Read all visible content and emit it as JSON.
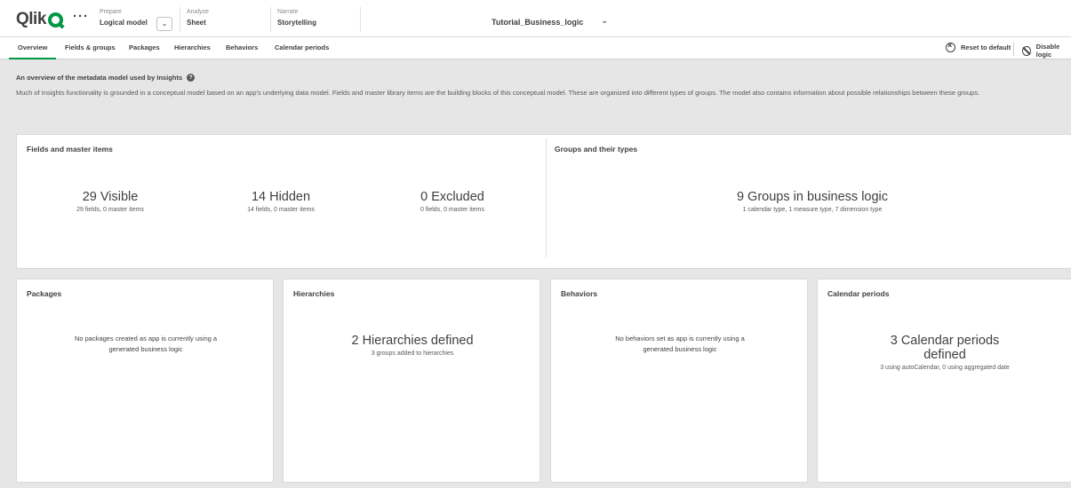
{
  "header": {
    "logo_text": "Qlik",
    "more_label": "···",
    "prepare": {
      "caption": "Prepare",
      "value": "Logical model"
    },
    "dropdown_icon": "chevron-down",
    "analyze": {
      "caption": "Analyze",
      "value": "Sheet"
    },
    "narrate": {
      "caption": "Narrate",
      "value": "Storytelling"
    },
    "app_title": "Tutorial_Business_logic",
    "app_caret": "⌄",
    "brand_color": "#009845"
  },
  "tabs": [
    {
      "label": "Overview",
      "active": true
    },
    {
      "label": "Fields & groups"
    },
    {
      "label": "Packages"
    },
    {
      "label": "Hierarchies"
    },
    {
      "label": "Behaviors"
    },
    {
      "label": "Calendar periods"
    }
  ],
  "actions": {
    "reset": "Reset to default",
    "disable": "Disable logic"
  },
  "intro": {
    "title": "An overview of the metadata model used by Insights",
    "description": "Much of Insights functionality is grounded in a conceptual model based on an app's underlying data model. Fields and master library items are the building blocks of this conceptual model. These are organized into different types of groups. The model also contains information about possible relationships between these groups."
  },
  "fields_card": {
    "title": "Fields and master items",
    "visible": {
      "value": "29 Visible",
      "detail": "29 fields, 0 master items"
    },
    "hidden": {
      "value": "14 Hidden",
      "detail": "14 fields, 0 master items"
    },
    "excluded": {
      "value": "0 Excluded",
      "detail": "0 fields, 0 master items"
    }
  },
  "groups_card": {
    "title": "Groups and their types",
    "value": "9 Groups in business logic",
    "detail": "1 calendar type, 1 measure type, 7 dimension type"
  },
  "packages_card": {
    "title": "Packages",
    "message": "No packages created as app is currently using a generated business logic"
  },
  "hierarchies_card": {
    "title": "Hierarchies",
    "value": "2 Hierarchies defined",
    "detail": "3 groups added to hierarchies"
  },
  "behaviors_card": {
    "title": "Behaviors",
    "message": "No behaviors set as app is currently using a generated business logic"
  },
  "calendar_card": {
    "title": "Calendar periods",
    "value": "3 Calendar periods defined",
    "detail": "3 using autoCalendar, 0 using aggregated date"
  }
}
